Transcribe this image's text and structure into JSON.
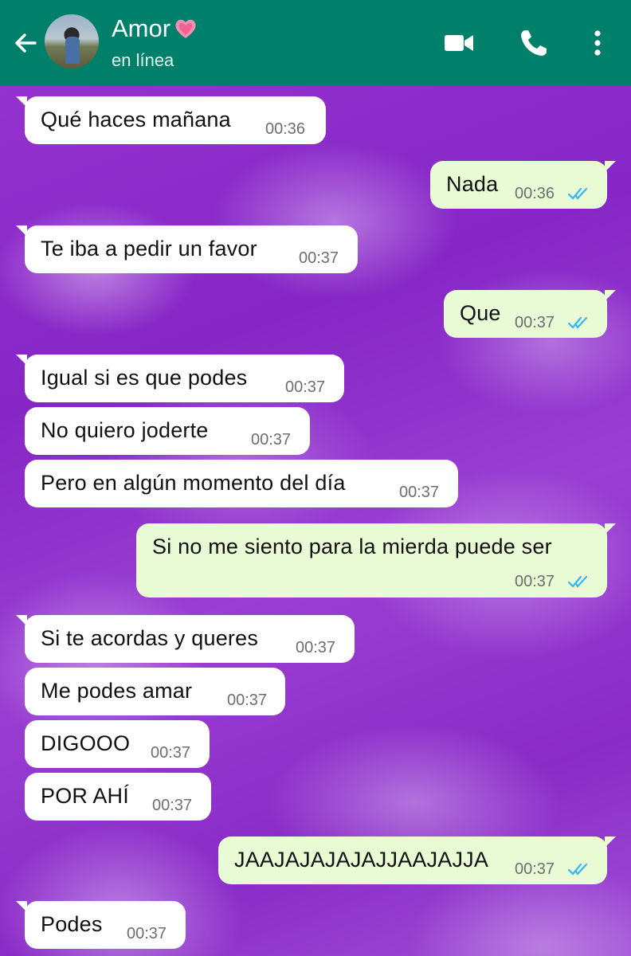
{
  "header": {
    "contact_name": "Amor",
    "status": "en línea",
    "bg_color": "#00806b"
  },
  "icons": {
    "back": "arrow-left-icon",
    "video": "video-call-icon",
    "call": "phone-icon",
    "menu": "more-vertical-icon",
    "read": "double-check-icon",
    "name_emoji": "pink-heart-icon"
  },
  "colors": {
    "incoming_bubble": "#ffffff",
    "outgoing_bubble": "#e8fbd5",
    "read_ticks": "#34b7f1",
    "wallpaper": "#8a2bc7"
  },
  "messages": [
    {
      "dir": "in",
      "text": "Qué haces mañana",
      "time": "00:36"
    },
    {
      "dir": "out",
      "text": "Nada",
      "time": "00:36",
      "read": true
    },
    {
      "dir": "in",
      "text": "Te iba a pedir un favor",
      "time": "00:37"
    },
    {
      "dir": "out",
      "text": "Que",
      "time": "00:37",
      "read": true
    },
    {
      "dir": "in",
      "text": "Igual si es que podes",
      "time": "00:37"
    },
    {
      "dir": "in",
      "text": "No quiero joderte",
      "time": "00:37"
    },
    {
      "dir": "in",
      "text": "Pero en algún momento del día",
      "time": "00:37"
    },
    {
      "dir": "out",
      "text": "Si no me siento para la mierda puede ser",
      "time": "00:37",
      "read": true
    },
    {
      "dir": "in",
      "text": "Si te acordas y queres",
      "time": "00:37"
    },
    {
      "dir": "in",
      "text": "Me podes amar",
      "time": "00:37"
    },
    {
      "dir": "in",
      "text": "DIGOOO",
      "time": "00:37"
    },
    {
      "dir": "in",
      "text": "POR AHÍ",
      "time": "00:37"
    },
    {
      "dir": "out",
      "text": "JAAJAJAJAJAJJAAJAJJA",
      "time": "00:37",
      "read": true
    },
    {
      "dir": "in",
      "text": "Podes",
      "time": "00:37"
    }
  ]
}
